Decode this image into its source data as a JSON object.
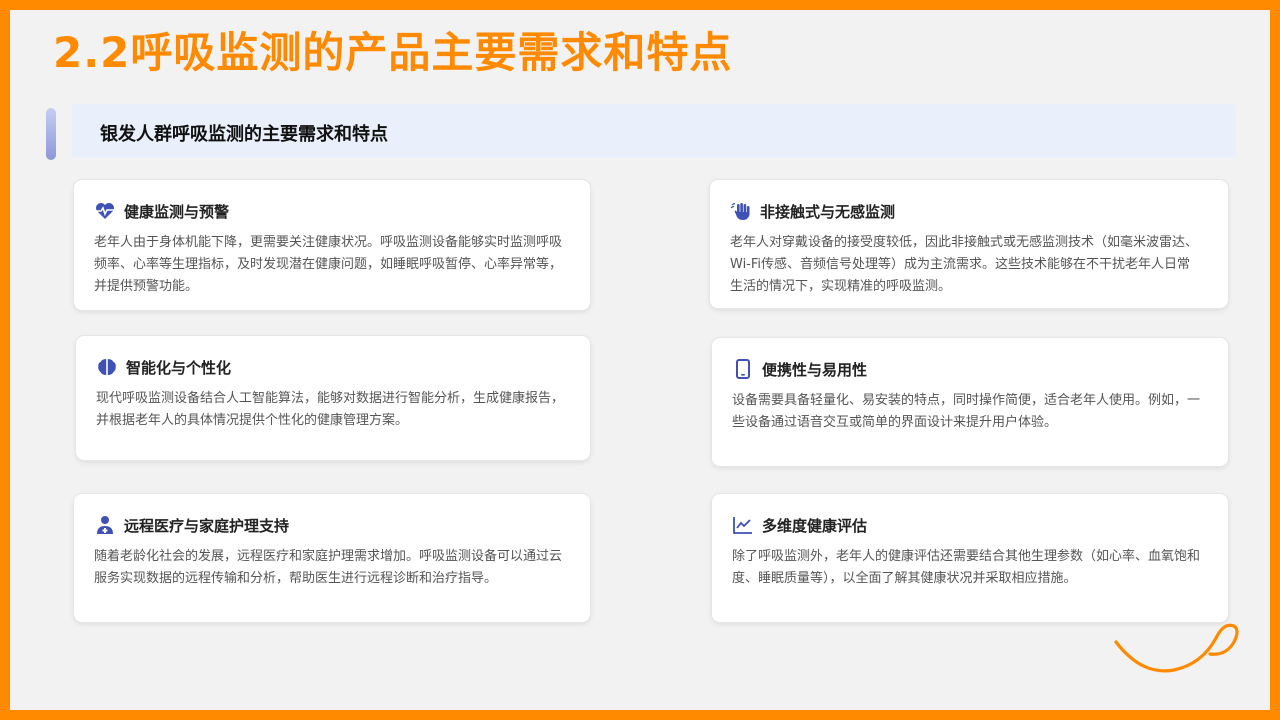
{
  "slide": {
    "title": "2.2呼吸监测的产品主要需求和特点",
    "subtitle": "银发人群呼吸监测的主要需求和特点"
  },
  "colors": {
    "accent": "#ff8a00",
    "icon": "#3f51b5",
    "subheader_bg": "#e9f0fb"
  },
  "cards": [
    {
      "icon": "heartbeat-icon",
      "title": "健康监测与预警",
      "body": "老年人由于身体机能下降，更需要关注健康状况。呼吸监测设备能够实时监测呼吸频率、心率等生理指标，及时发现潜在健康问题，如睡眠呼吸暂停、心率异常等，并提供预警功能。"
    },
    {
      "icon": "hand-wave-icon",
      "title": "非接触式与无感监测",
      "body": "老年人对穿戴设备的接受度较低，因此非接触式或无感监测技术（如毫米波雷达、Wi-Fi传感、音频信号处理等）成为主流需求。这些技术能够在不干扰老年人日常生活的情况下，实现精准的呼吸监测。"
    },
    {
      "icon": "brain-icon",
      "title": "智能化与个性化",
      "body": "现代呼吸监测设备结合人工智能算法，能够对数据进行智能分析，生成健康报告，并根据老年人的具体情况提供个性化的健康管理方案。"
    },
    {
      "icon": "tablet-icon",
      "title": "便携性与易用性",
      "body": "设备需要具备轻量化、易安装的特点，同时操作简便，适合老年人使用。例如，一些设备通过语音交互或简单的界面设计来提升用户体验。"
    },
    {
      "icon": "doctor-icon",
      "title": "远程医疗与家庭护理支持",
      "body": "随着老龄化社会的发展，远程医疗和家庭护理需求增加。呼吸监测设备可以通过云服务实现数据的远程传输和分析，帮助医生进行远程诊断和治疗指导。"
    },
    {
      "icon": "line-chart-icon",
      "title": "多维度健康评估",
      "body": "除了呼吸监测外，老年人的健康评估还需要结合其他生理参数（如心率、血氧饱和度、睡眠质量等），以全面了解其健康状况并采取相应措施。"
    }
  ]
}
